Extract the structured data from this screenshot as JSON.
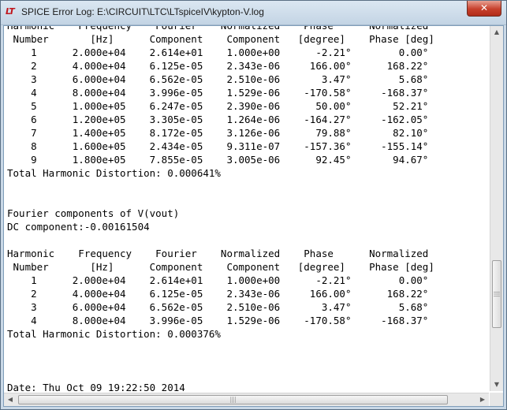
{
  "window": {
    "title": "SPICE Error Log: E:\\CIRCUIT\\LTC\\LTspiceIV\\kypton-V.log",
    "icon_text": "LT",
    "close_label": "✕"
  },
  "log_lines": [
    "Harmonic    Frequency    Fourier    Normalized    Phase      Normalized",
    " Number       [Hz]      Component    Component   [degree]    Phase [deg]",
    "    1      2.000e+04    2.614e+01    1.000e+00      -2.21°        0.00°",
    "    2      4.000e+04    6.125e-05    2.343e-06     166.00°      168.22°",
    "    3      6.000e+04    6.562e-05    2.510e-06       3.47°        5.68°",
    "    4      8.000e+04    3.996e-05    1.529e-06    -170.58°     -168.37°",
    "    5      1.000e+05    6.247e-05    2.390e-06      50.00°       52.21°",
    "    6      1.200e+05    3.305e-05    1.264e-06    -164.27°     -162.05°",
    "    7      1.400e+05    8.172e-05    3.126e-06      79.88°       82.10°",
    "    8      1.600e+05    2.434e-05    9.311e-07    -157.36°     -155.14°",
    "    9      1.800e+05    7.855e-05    3.005e-06      92.45°       94.67°",
    "Total Harmonic Distortion: 0.000641%",
    "",
    "",
    "Fourier components of V(vout)",
    "DC component:-0.00161504",
    "",
    "Harmonic    Frequency    Fourier    Normalized    Phase      Normalized",
    " Number       [Hz]      Component    Component   [degree]    Phase [deg]",
    "    1      2.000e+04    2.614e+01    1.000e+00      -2.21°        0.00°",
    "    2      4.000e+04    6.125e-05    2.343e-06     166.00°      168.22°",
    "    3      6.000e+04    6.562e-05    2.510e-06       3.47°        5.68°",
    "    4      8.000e+04    3.996e-05    1.529e-06    -170.58°     -168.37°",
    "Total Harmonic Distortion: 0.000376%",
    "",
    "",
    "",
    "Date: Thu Oct 09 19:22:50 2014"
  ],
  "scrollbars": {
    "up_arrow": "▲",
    "down_arrow": "▼",
    "left_arrow": "◀",
    "right_arrow": "▶",
    "grip": "|||"
  }
}
